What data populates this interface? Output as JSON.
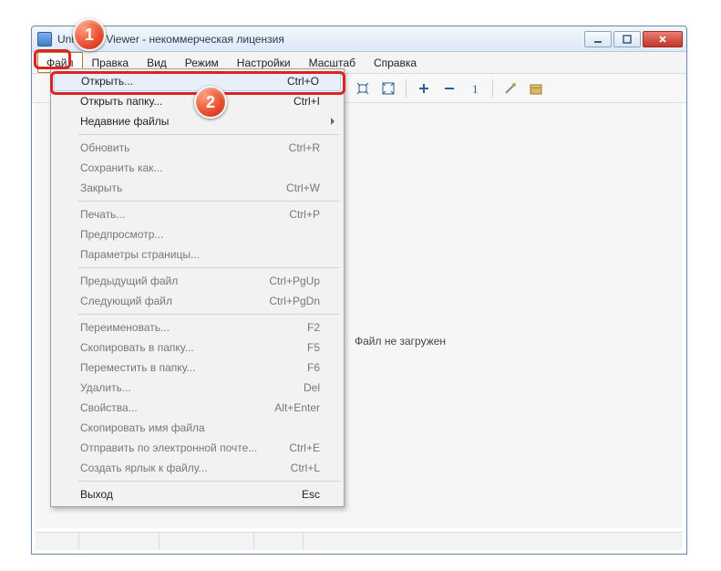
{
  "window": {
    "title": "Universal Viewer - некоммерческая лицензия"
  },
  "menubar": [
    "Файл",
    "Правка",
    "Вид",
    "Режим",
    "Настройки",
    "Масштаб",
    "Справка"
  ],
  "dropdown": {
    "groups": [
      [
        {
          "label": "Открыть...",
          "shortcut": "Ctrl+O",
          "enabled": true,
          "highlight": true
        },
        {
          "label": "Открыть папку...",
          "shortcut": "Ctrl+I",
          "enabled": true
        },
        {
          "label": "Недавние файлы",
          "shortcut": "",
          "enabled": true,
          "submenu": true
        }
      ],
      [
        {
          "label": "Обновить",
          "shortcut": "Ctrl+R",
          "enabled": false
        },
        {
          "label": "Сохранить как...",
          "shortcut": "",
          "enabled": false
        },
        {
          "label": "Закрыть",
          "shortcut": "Ctrl+W",
          "enabled": false
        }
      ],
      [
        {
          "label": "Печать...",
          "shortcut": "Ctrl+P",
          "enabled": false
        },
        {
          "label": "Предпросмотр...",
          "shortcut": "",
          "enabled": false
        },
        {
          "label": "Параметры страницы...",
          "shortcut": "",
          "enabled": false
        }
      ],
      [
        {
          "label": "Предыдущий файл",
          "shortcut": "Ctrl+PgUp",
          "enabled": false
        },
        {
          "label": "Следующий файл",
          "shortcut": "Ctrl+PgDn",
          "enabled": false
        }
      ],
      [
        {
          "label": "Переименовать...",
          "shortcut": "F2",
          "enabled": false
        },
        {
          "label": "Скопировать в папку...",
          "shortcut": "F5",
          "enabled": false
        },
        {
          "label": "Переместить в папку...",
          "shortcut": "F6",
          "enabled": false
        },
        {
          "label": "Удалить...",
          "shortcut": "Del",
          "enabled": false
        },
        {
          "label": "Свойства...",
          "shortcut": "Alt+Enter",
          "enabled": false
        },
        {
          "label": "Скопировать имя файла",
          "shortcut": "",
          "enabled": false
        },
        {
          "label": "Отправить по электронной почте...",
          "shortcut": "Ctrl+E",
          "enabled": false
        },
        {
          "label": "Создать ярлык к файлу...",
          "shortcut": "Ctrl+L",
          "enabled": false
        }
      ],
      [
        {
          "label": "Выход",
          "shortcut": "Esc",
          "enabled": true
        }
      ]
    ]
  },
  "content": {
    "message": "Файл не загружен"
  },
  "callouts": {
    "c1": "1",
    "c2": "2"
  }
}
